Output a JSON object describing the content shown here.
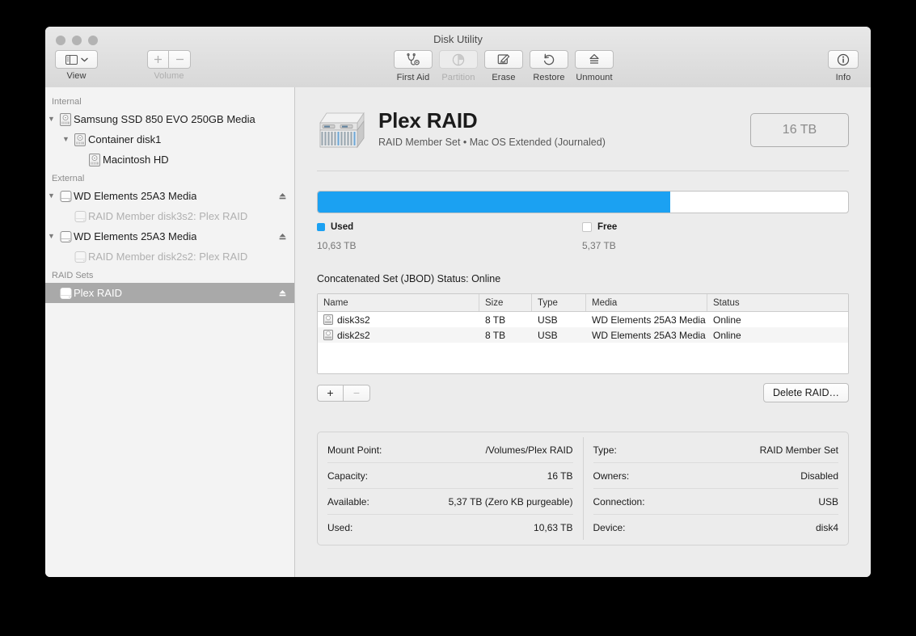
{
  "window": {
    "title": "Disk Utility",
    "traffic_lights": [
      "close-button",
      "minimize-button",
      "zoom-button"
    ]
  },
  "toolbar": {
    "view": {
      "label": "View",
      "icon": "sidebar-icon",
      "chevron": "chevron-down-icon"
    },
    "volume": {
      "label": "Volume",
      "add_label": "+",
      "remove_label": "−",
      "enabled": false
    },
    "actions": [
      {
        "label": "First Aid",
        "icon": "stethoscope-icon",
        "enabled": true
      },
      {
        "label": "Partition",
        "icon": "pie-chart-icon",
        "enabled": false
      },
      {
        "label": "Erase",
        "icon": "erase-icon",
        "enabled": true
      },
      {
        "label": "Restore",
        "icon": "restore-icon",
        "enabled": true
      },
      {
        "label": "Unmount",
        "icon": "eject-icon",
        "enabled": true
      }
    ],
    "info": {
      "label": "Info",
      "icon": "info-circle-icon"
    }
  },
  "sidebar": {
    "sections": [
      {
        "header": "Internal",
        "items": [
          {
            "label": "Samsung SSD 850 EVO 250GB Media",
            "indent": 0,
            "twisty": "▼",
            "icon": "internal-disk-icon",
            "dim": false,
            "eject": false,
            "selected": false
          },
          {
            "label": "Container disk1",
            "indent": 1,
            "twisty": "▼",
            "icon": "internal-disk-icon",
            "dim": false,
            "eject": false,
            "selected": false
          },
          {
            "label": "Macintosh HD",
            "indent": 2,
            "twisty": "",
            "icon": "internal-disk-icon",
            "dim": false,
            "eject": false,
            "selected": false
          }
        ]
      },
      {
        "header": "External",
        "items": [
          {
            "label": "WD Elements 25A3 Media",
            "indent": 0,
            "twisty": "▼",
            "icon": "external-disk-icon",
            "dim": false,
            "eject": true,
            "selected": false
          },
          {
            "label": "RAID Member disk3s2: Plex RAID",
            "indent": 1,
            "twisty": "",
            "icon": "external-disk-icon",
            "dim": true,
            "eject": false,
            "selected": false
          },
          {
            "label": "WD Elements 25A3 Media",
            "indent": 0,
            "twisty": "▼",
            "icon": "external-disk-icon",
            "dim": false,
            "eject": true,
            "selected": false
          },
          {
            "label": "RAID Member disk2s2: Plex RAID",
            "indent": 1,
            "twisty": "",
            "icon": "external-disk-icon",
            "dim": true,
            "eject": false,
            "selected": false
          }
        ]
      },
      {
        "header": "RAID Sets",
        "items": [
          {
            "label": "Plex RAID",
            "indent": 0,
            "twisty": "",
            "icon": "external-disk-icon",
            "dim": false,
            "eject": true,
            "selected": true
          }
        ]
      }
    ]
  },
  "main": {
    "device": {
      "name": "Plex RAID",
      "subtitle": "RAID Member Set • Mac OS Extended (Journaled)",
      "icon": "raid-enclosure-icon",
      "capacity_badge": "16 TB"
    },
    "capacity": {
      "used_label": "Used",
      "used_value": "10,63 TB",
      "free_label": "Free",
      "free_value": "5,37 TB",
      "used_percent": 66.4,
      "used_color": "#1ba1f2",
      "free_color": "#ffffff"
    },
    "raid": {
      "status_line": "Concatenated Set (JBOD) Status: Online",
      "columns": [
        "Name",
        "Size",
        "Type",
        "Media",
        "Status"
      ],
      "rows": [
        {
          "name": "disk3s2",
          "size": "8 TB",
          "type": "USB",
          "media": "WD Elements 25A3 Media",
          "status": "Online",
          "icon": "disk-icon"
        },
        {
          "name": "disk2s2",
          "size": "8 TB",
          "type": "USB",
          "media": "WD Elements 25A3 Media",
          "status": "Online",
          "icon": "disk-icon"
        }
      ],
      "add_label": "+",
      "remove_label": "−",
      "delete_label": "Delete RAID…"
    },
    "info": {
      "left": [
        {
          "label": "Mount Point:",
          "value": "/Volumes/Plex RAID"
        },
        {
          "label": "Capacity:",
          "value": "16 TB"
        },
        {
          "label": "Available:",
          "value": "5,37 TB (Zero KB purgeable)"
        },
        {
          "label": "Used:",
          "value": "10,63 TB"
        }
      ],
      "right": [
        {
          "label": "Type:",
          "value": "RAID Member Set"
        },
        {
          "label": "Owners:",
          "value": "Disabled"
        },
        {
          "label": "Connection:",
          "value": "USB"
        },
        {
          "label": "Device:",
          "value": "disk4"
        }
      ]
    }
  }
}
